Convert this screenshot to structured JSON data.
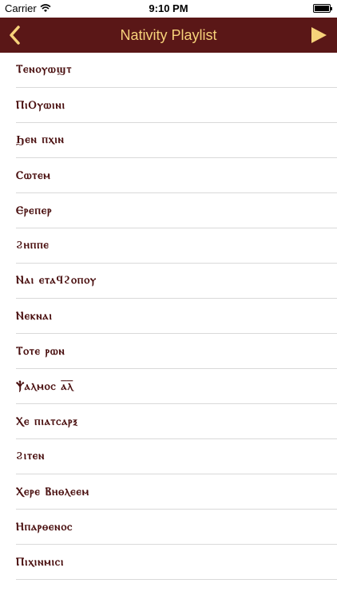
{
  "status": {
    "carrier": "Carrier",
    "time": "9:10 PM",
    "battery_level": 1.0
  },
  "nav": {
    "title": "Nativity Playlist",
    "back_icon": "chevron-left-icon",
    "play_icon": "play-icon",
    "accent": "#f7d27a",
    "background": "#5a1717"
  },
  "items": [
    {
      "label": "Ⲧⲉⲛⲟⲩⲱϣⲧ"
    },
    {
      "label": "ⲠⲓⲞⲩⲱⲓⲛⲓ"
    },
    {
      "label": "Ϧⲉⲛ ⲡⲭⲓⲛ"
    },
    {
      "label": "Ⲥⲱⲧⲉⲙ"
    },
    {
      "label": "Ⲉⲣⲉⲡⲉⲣ"
    },
    {
      "label": "Ϩⲏⲡⲡⲉ"
    },
    {
      "label": "Ⲛⲁⲓ ⲉⲧⲁϥϩⲟⲡⲟⲩ"
    },
    {
      "label": "Ⲛⲉⲕⲛⲁⲓ"
    },
    {
      "label": "Ⲧⲟⲧⲉ ⲣⲱⲛ"
    },
    {
      "label": "Ⲯⲁⲗⲙⲟⲥ ⲁ̅ⲗ̅"
    },
    {
      "label": "Ⲭⲉ ⲡⲓⲁⲧⲥⲁⲣⲝ"
    },
    {
      "label": "Ϩⲓⲧⲉⲛ"
    },
    {
      "label": "Ⲭⲉⲣⲉ Ⲃⲏⲑⲗⲉⲉⲙ"
    },
    {
      "label": "Ⲏⲡⲁⲣⲑⲉⲛⲟⲥ"
    },
    {
      "label": "Ⲡⲓⲭⲓⲛⲙⲓⲥⲓ"
    }
  ]
}
